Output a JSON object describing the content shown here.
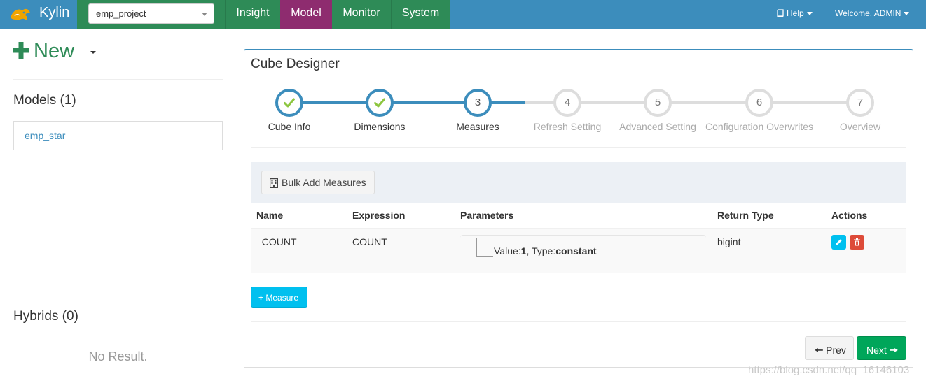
{
  "app": {
    "brand": "Kylin"
  },
  "project_select": {
    "value": "emp_project"
  },
  "nav": {
    "tabs": [
      {
        "label": "Insight"
      },
      {
        "label": "Model"
      },
      {
        "label": "Monitor"
      },
      {
        "label": "System"
      }
    ],
    "active_tab": "Model",
    "help_label": "Help",
    "welcome_label": "Welcome, ADMIN"
  },
  "colors": {
    "navbar": "#3c8dbc",
    "nav_green": "#2e8b57",
    "nav_active": "#8e2c6f",
    "step_done": "#3c8dbc",
    "check": "#8dc63f",
    "info": "#00c0ef",
    "danger": "#dd4b39",
    "success": "#00a65a"
  },
  "sidebar": {
    "new_label": "New",
    "models_title": "Models (1)",
    "models": [
      {
        "label": "emp_star"
      }
    ],
    "hybrids_title": "Hybrids (0)",
    "empty_text": "No Result."
  },
  "designer": {
    "title": "Cube Designer",
    "steps": [
      {
        "number": "1",
        "label": "Cube Info",
        "state": "done"
      },
      {
        "number": "2",
        "label": "Dimensions",
        "state": "done"
      },
      {
        "number": "3",
        "label": "Measures",
        "state": "current"
      },
      {
        "number": "4",
        "label": "Refresh Setting",
        "state": "future"
      },
      {
        "number": "5",
        "label": "Advanced Setting",
        "state": "future"
      },
      {
        "number": "6",
        "label": "Configuration Overwrites",
        "state": "future"
      },
      {
        "number": "7",
        "label": "Overview",
        "state": "future"
      }
    ],
    "bulk_add_label": "Bulk Add Measures",
    "table": {
      "headers": [
        "Name",
        "Expression",
        "Parameters",
        "Return Type",
        "Actions"
      ],
      "rows": [
        {
          "name": "_COUNT_",
          "expression": "COUNT",
          "param_value_label": "Value:",
          "param_value": "1",
          "param_type_label": ", Type:",
          "param_type": "constant",
          "return_type": "bigint"
        }
      ]
    },
    "add_measure_label": "Measure",
    "prev_label": "Prev",
    "next_label": "Next"
  },
  "watermark": "https://blog.csdn.net/qq_16146103"
}
